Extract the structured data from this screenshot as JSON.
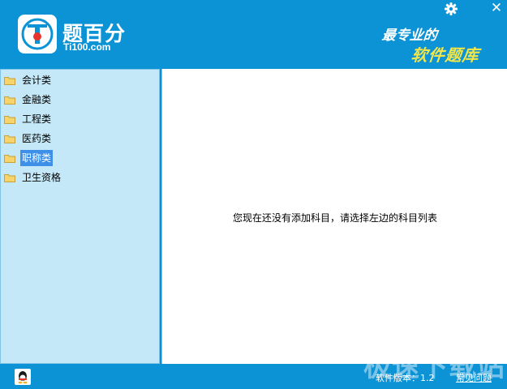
{
  "header": {
    "app_name": "题百分",
    "app_domain": "Ti100.com",
    "slogan_line1": "最专业的",
    "slogan_line2": "软件题库",
    "settings_icon": "gear-icon",
    "close_label": "✕"
  },
  "sidebar": {
    "items": [
      {
        "label": "会计类",
        "icon": "folder-icon",
        "selected": false
      },
      {
        "label": "金融类",
        "icon": "folder-icon",
        "selected": false
      },
      {
        "label": "工程类",
        "icon": "folder-icon",
        "selected": false
      },
      {
        "label": "医药类",
        "icon": "folder-icon",
        "selected": false
      },
      {
        "label": "职称类",
        "icon": "folder-icon",
        "selected": true
      },
      {
        "label": "卫生资格",
        "icon": "folder-icon",
        "selected": false
      }
    ]
  },
  "main": {
    "empty_message": "您现在还没有添加科目，请选择左边的科目列表"
  },
  "footer": {
    "qq_icon": "qq-icon",
    "version_text": "软件版本：1.2",
    "faq_label": "常见问题"
  },
  "watermark": "极速下载站",
  "colors": {
    "header_bg": "#0b93d6",
    "sidebar_bg": "#c4e8f7",
    "selected_bg": "#3d8fe8",
    "slogan_accent": "#f3e64a"
  }
}
